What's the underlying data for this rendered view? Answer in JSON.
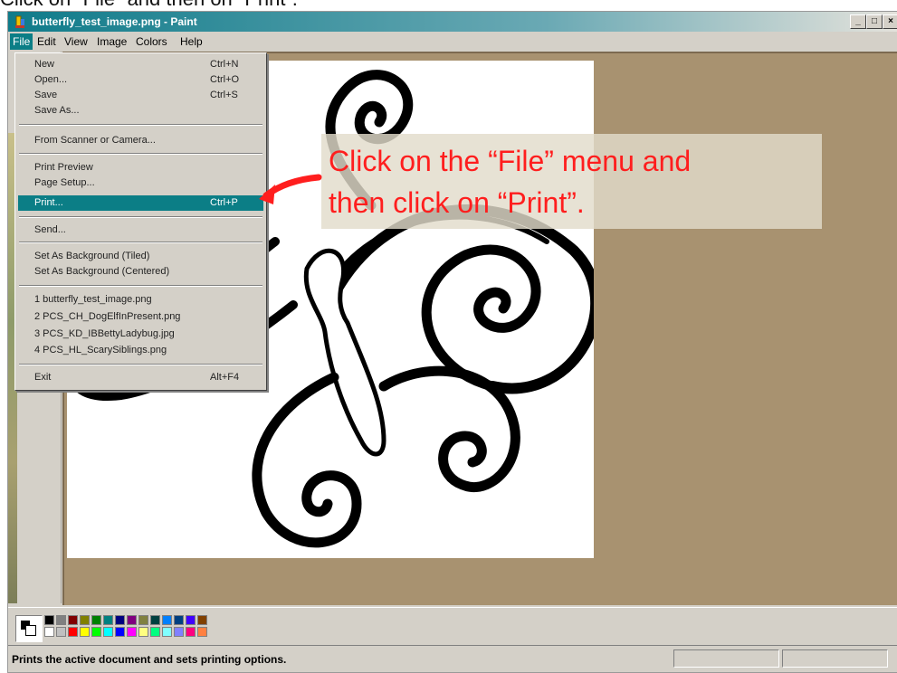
{
  "instruction": "Click on “File” and then on “Print”.",
  "window": {
    "title": "butterfly_test_image.png - Paint",
    "controls": {
      "minimize": "_",
      "maximize": "□",
      "close": "×"
    }
  },
  "menubar": [
    "File",
    "Edit",
    "View",
    "Image",
    "Colors",
    "Help"
  ],
  "file_menu": {
    "items": [
      {
        "label": "New",
        "shortcut": "Ctrl+N"
      },
      {
        "label": "Open...",
        "shortcut": "Ctrl+O"
      },
      {
        "label": "Save",
        "shortcut": "Ctrl+S"
      },
      {
        "label": "Save As...",
        "shortcut": ""
      },
      {
        "label": "From Scanner or Camera...",
        "shortcut": ""
      },
      {
        "label": "Print Preview",
        "shortcut": ""
      },
      {
        "label": "Page Setup...",
        "shortcut": ""
      },
      {
        "label": "Print...",
        "shortcut": "Ctrl+P",
        "highlighted": true
      },
      {
        "label": "Send...",
        "shortcut": ""
      },
      {
        "label": "Set As Background (Tiled)",
        "shortcut": ""
      },
      {
        "label": "Set As Background (Centered)",
        "shortcut": ""
      },
      {
        "label": "1 butterfly_test_image.png",
        "shortcut": ""
      },
      {
        "label": "2 PCS_CH_DogElfInPresent.png",
        "shortcut": ""
      },
      {
        "label": "3 PCS_KD_IBBettyLadybug.jpg",
        "shortcut": ""
      },
      {
        "label": "4 PCS_HL_ScarySiblings.png",
        "shortcut": ""
      },
      {
        "label": "Exit",
        "shortcut": "Alt+F4"
      }
    ]
  },
  "callout": {
    "line1": "Click on the “File” menu and",
    "line2": "then click on “Print”.",
    "text_color": "#ff1e1e"
  },
  "status": {
    "text": "Prints the active document and sets printing options."
  },
  "palette": {
    "top": [
      "#000000",
      "#808080",
      "#800000",
      "#808000",
      "#008000",
      "#008080",
      "#000080",
      "#800080",
      "#808040",
      "#004040",
      "#0080ff",
      "#004080",
      "#4000ff",
      "#804000"
    ],
    "bottom": [
      "#ffffff",
      "#c0c0c0",
      "#ff0000",
      "#ffff00",
      "#00ff00",
      "#00ffff",
      "#0000ff",
      "#ff00ff",
      "#ffff80",
      "#00ff80",
      "#80ffff",
      "#8080ff",
      "#ff0080",
      "#ff8040"
    ]
  },
  "colors": {
    "highlight": "#0b7e86",
    "canvas_bg": "#a89270",
    "chrome": "#d4d0c8"
  }
}
